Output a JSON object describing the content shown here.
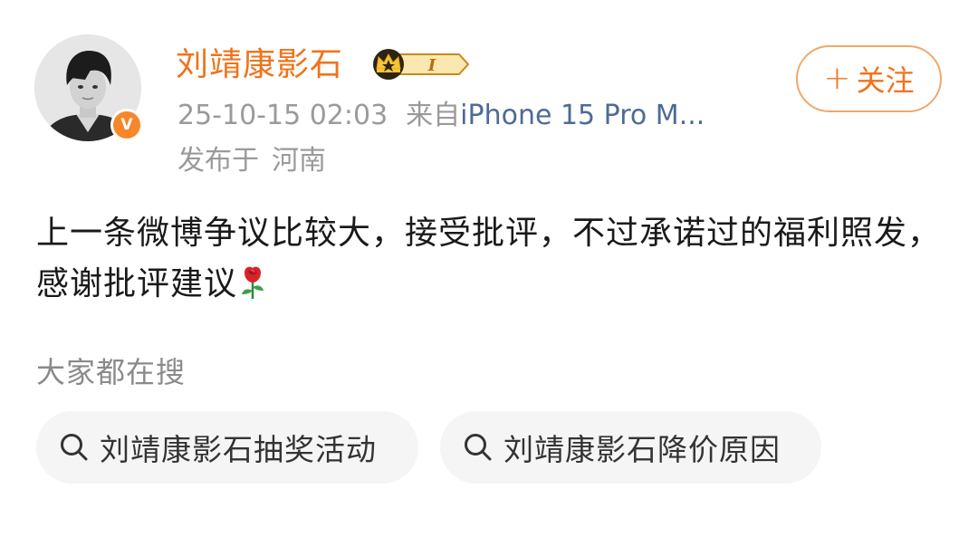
{
  "user": {
    "name": "刘靖康影石",
    "verify_badge_letter": "V",
    "vip_level": "I"
  },
  "meta": {
    "timestamp": "25-10-15 02:03",
    "source_prefix": "来自",
    "device": "iPhone 15 Pro M...",
    "location_prefix": "发布于",
    "location": "河南"
  },
  "follow": {
    "plus": "+",
    "label": "关注"
  },
  "post": {
    "text": "上一条微博争议比较大，接受批评，不过承诺过的福利照发，感谢批评建议",
    "emoji": "rose-icon"
  },
  "trending": {
    "title": "大家都在搜",
    "items": [
      {
        "label": "刘靖康影石抽奖活动",
        "icon": "search-icon"
      },
      {
        "label": "刘靖康影石降价原因",
        "icon": "search-icon"
      }
    ]
  },
  "colors": {
    "brand_orange": "#f0731b",
    "follow_border": "#f0a86a",
    "meta_gray": "#9a9a9a",
    "device_blue": "#4d6b97",
    "chip_bg": "#f5f5f5",
    "verify_orange": "#f8862a"
  }
}
